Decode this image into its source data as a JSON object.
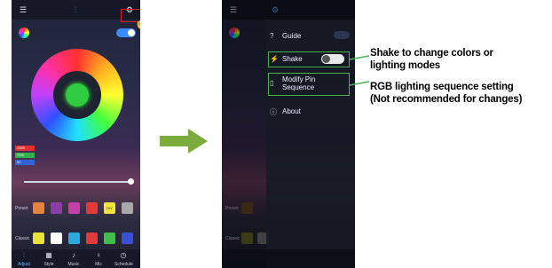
{
  "left_screen": {
    "menu_icon": "hamburger-icon",
    "tab_icon": "sliders-icon",
    "settings_icon": "gear-icon",
    "chips": [
      "2393",
      "71%",
      "52"
    ],
    "chip_colors": [
      "#e03030",
      "#2fb34a",
      "#2f63d6"
    ],
    "preset_label": "Preset",
    "preset_swatches": [
      "#e8823a",
      "#8a3fa8",
      "#c43fa8",
      "#e03a3a",
      "#f0e33a",
      "#a8a8a8"
    ],
    "preset_tail_text": "DIY",
    "classic_label": "Classic",
    "classic_swatches": [
      "#e8e336",
      "#ffffff",
      "#2aa8e0",
      "#e03a3a",
      "#3fbf4a",
      "#3a4fd6"
    ],
    "nav": [
      {
        "icon": "adjust-icon",
        "label": "Adjust"
      },
      {
        "icon": "style-icon",
        "label": "Style"
      },
      {
        "icon": "music-icon",
        "label": "Music"
      },
      {
        "icon": "mic-icon",
        "label": "Mic"
      },
      {
        "icon": "schedule-icon",
        "label": "Schedule"
      }
    ]
  },
  "right_screen": {
    "menu_items": [
      {
        "icon": "question-icon",
        "label": "Guide"
      },
      {
        "icon": "shake-icon",
        "label": "Shake"
      },
      {
        "icon": "pin-icon",
        "label": "Modify Pin\nSequence"
      },
      {
        "icon": "info-icon",
        "label": "About"
      }
    ],
    "preset_label": "Preset",
    "classic_label": "Classic"
  },
  "annotations": {
    "shake": "Shake to change colors or\nlighting modes",
    "rgb": "RGB lighting sequence setting\n(Not recommended for changes)"
  },
  "colors": {
    "arrow": "#7cad3c",
    "highlight": "#e02020",
    "callout": "#4caf50",
    "accent": "#3a8bff"
  }
}
